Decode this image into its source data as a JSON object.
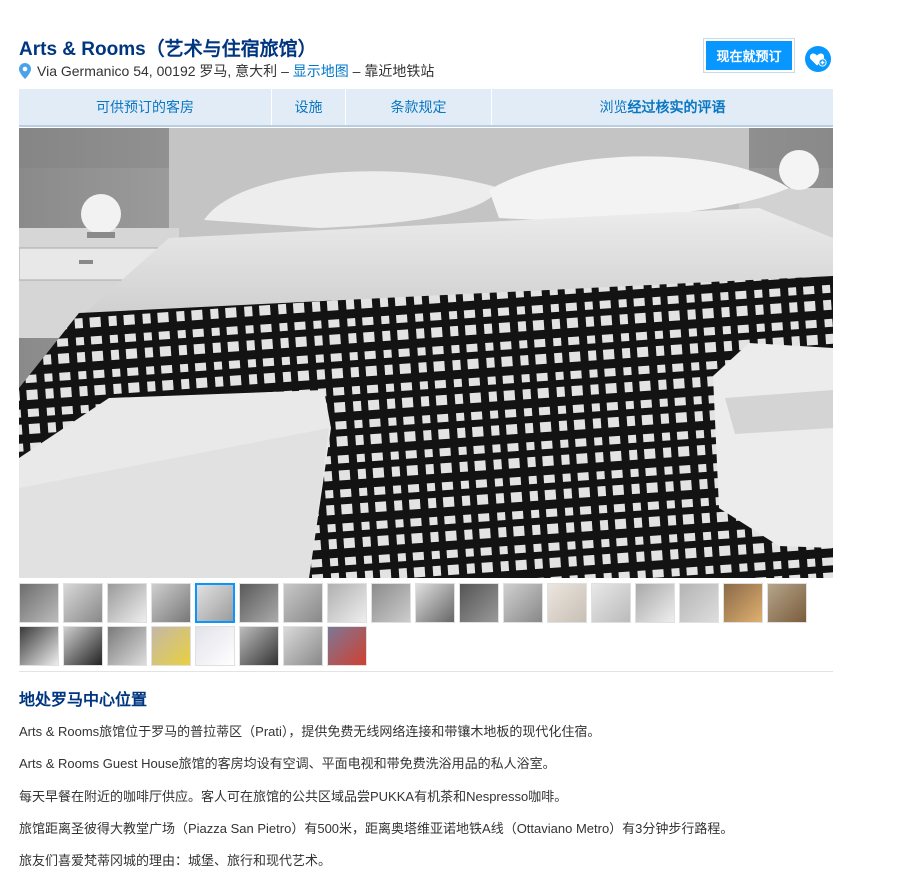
{
  "header": {
    "title": "Arts & Rooms（艺术与住宿旅馆）",
    "address": "Via Germanico 54, 00192 罗马, 意大利",
    "sep1": " – ",
    "map_link": "显示地图",
    "sep2": " – ",
    "metro_note": "靠近地铁站",
    "book_button": "现在就预订",
    "wishlist_icon": "heart-plus-icon"
  },
  "tabs": [
    {
      "label": "可供预订的客房"
    },
    {
      "label": "设施"
    },
    {
      "label": "条款规定"
    },
    {
      "label_prefix": "浏览",
      "label_bold": "经过核实的评语"
    }
  ],
  "gallery": {
    "main_photo": "bedroom-bed-photo",
    "selected_index": 4,
    "thumbnails": [
      "corridor-thumb",
      "door-thumb",
      "bathroom-thumb",
      "bed-towels-thumb",
      "bed-thumb",
      "room-dark-thumb",
      "window-thumb",
      "shower-thumb",
      "bathroom-glass-thumb",
      "toilet-thumb",
      "room-white-thumb",
      "bath-thumb",
      "room-pink-thumb",
      "curtain-thumb",
      "room-wide-thumb",
      "wall-grey-thumb",
      "lights-thumb",
      "artwork-thumb",
      "newyork-poster-thumb",
      "lounge-thumb",
      "hallway-thumb",
      "breakfast-thumb",
      "cups-thumb",
      "roma-sign-thumb",
      "kettle-thumb",
      "metro-street-thumb"
    ]
  },
  "description": {
    "title": "地处罗马中心位置",
    "paragraphs": [
      "Arts & Rooms旅馆位于罗马的普拉蒂区（Prati），提供免费无线网络连接和带镶木地板的现代化住宿。",
      "Arts & Rooms Guest House旅馆的客房均设有空调、平面电视和带免费洗浴用品的私人浴室。",
      "每天早餐在附近的咖啡厅供应。客人可在旅馆的公共区域品尝PUKKA有机茶和Nespresso咖啡。",
      "旅馆距离圣彼得大教堂广场（Piazza San Pietro）有500米，距离奥塔维亚诺地铁A线（Ottaviano Metro）有3分钟步行路程。",
      "旅友们喜爱梵蒂冈城的理由：城堡、旅行和现代艺术。"
    ]
  },
  "colors": {
    "brand": "#003580",
    "link": "#0077cc",
    "button": "#0896ff",
    "tab_bg": "#e2ecf7"
  }
}
